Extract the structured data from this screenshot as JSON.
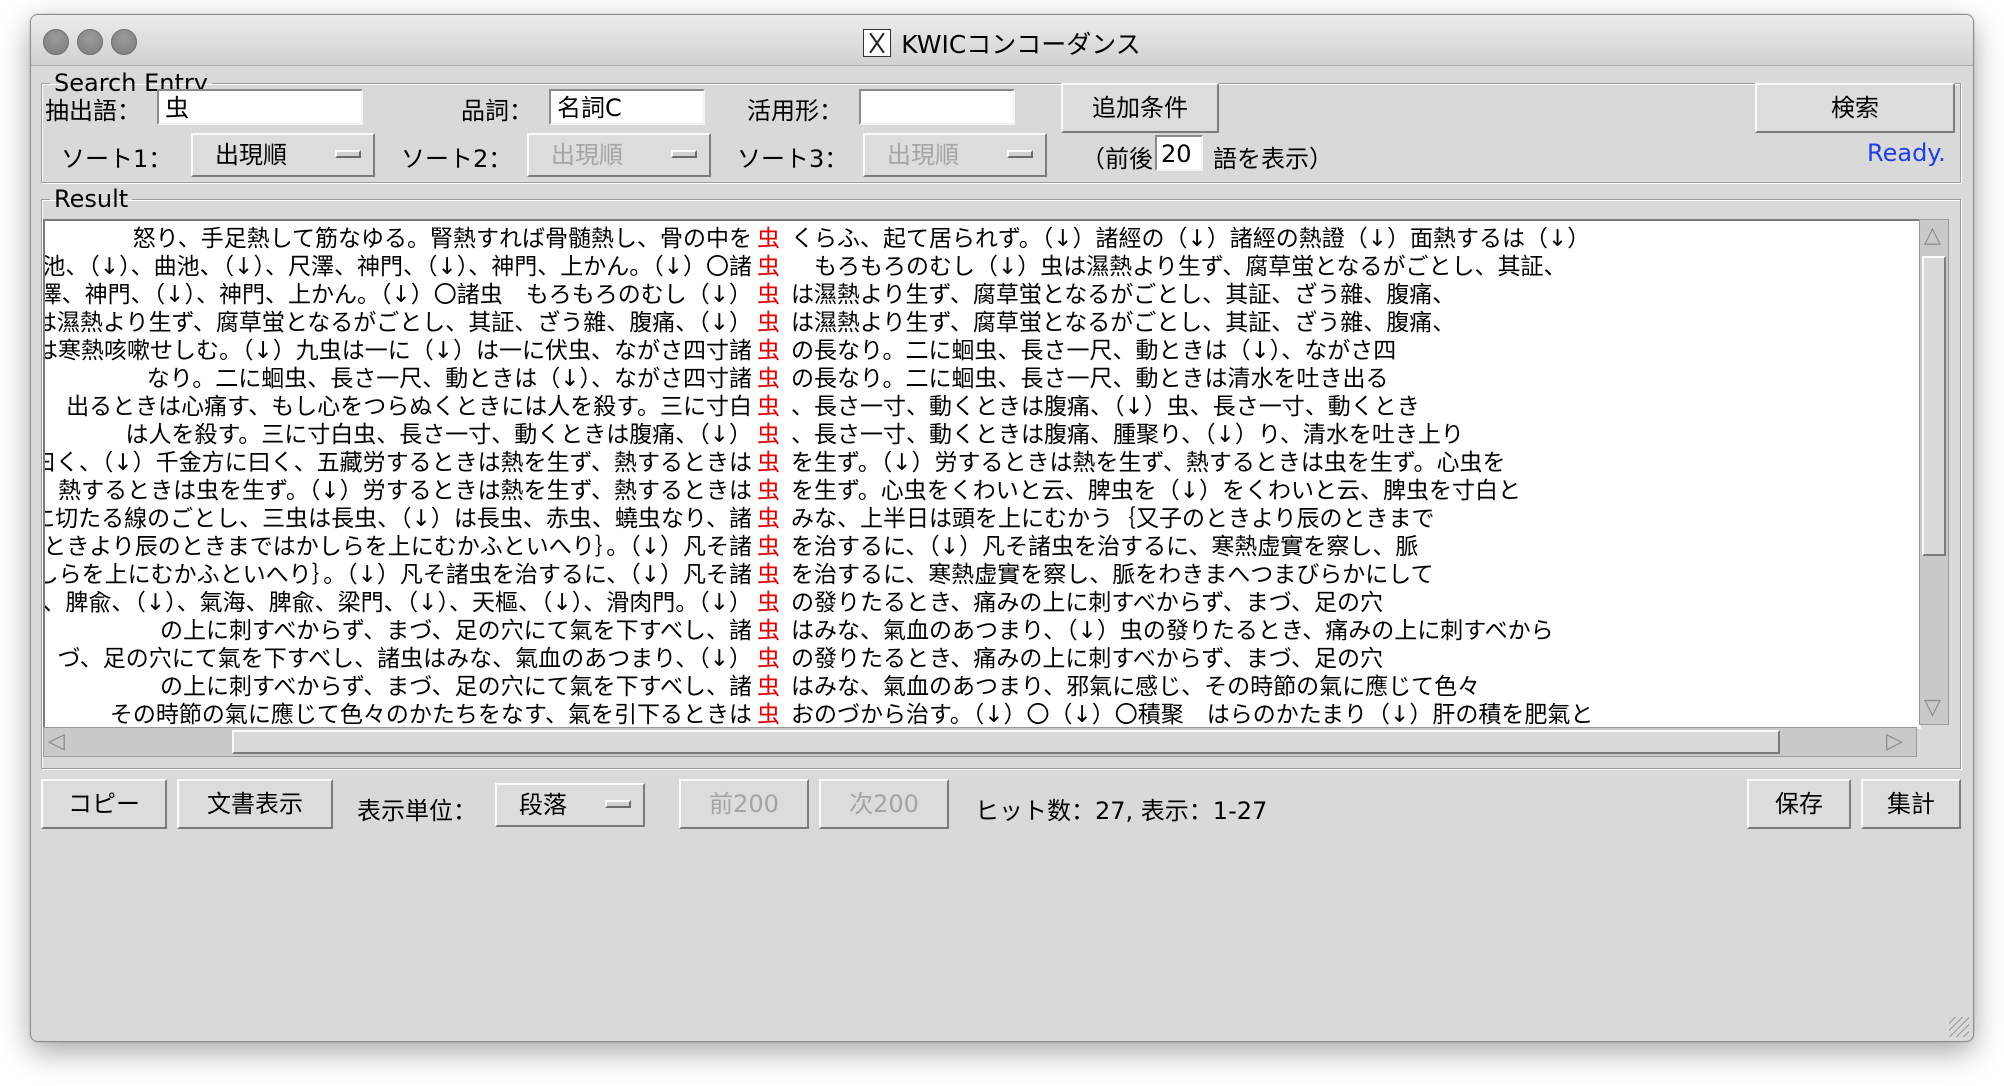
{
  "window": {
    "title": "KWICコンコーダンス"
  },
  "search_entry": {
    "legend": "Search Entry",
    "extract_label": "抽出語：",
    "extract_value": "虫",
    "pos_label": "品詞：",
    "pos_value": "名詞C",
    "conj_label": "活用形：",
    "conj_value": "",
    "add_condition_button": "追加条件",
    "search_button": "検索",
    "sort1_label": "ソート1：",
    "sort1_value": "出現順",
    "sort2_label": "ソート2：",
    "sort2_value": "出現順",
    "sort3_label": "ソート3：",
    "sort3_value": "出現順",
    "context_prefix": "（前後",
    "context_value": "20",
    "context_suffix": "語を表示）",
    "status": "Ready."
  },
  "result": {
    "legend": "Result",
    "keyword": "虫",
    "rows": [
      {
        "left": "怒り、手足熱して筋なゆる。腎熱すれば骨髄熱し、骨の中を",
        "right": "くらふ、起て居られず。（↓）諸經の（↓）諸經の熱證（↓）面熱するは（↓）"
      },
      {
        "left": "池、（↓）、曲池、（↓）、尺澤、神門、（↓）、神門、上かん。（↓）〇諸",
        "right": "　もろもろのむし（↓）虫は濕熱より生ず、腐草蛍となるがごとし、其証、"
      },
      {
        "left": "、尺澤、神門、（↓）、神門、上かん。（↓）〇諸虫　もろもろのむし（↓）",
        "right": "は濕熱より生ず、腐草蛍となるがごとし、其証、ざう雜、腹痛、"
      },
      {
        "left": "は濕熱より生ず、腐草蛍となるがごとし、其証、ざう雜、腹痛、（↓）",
        "right": "は濕熱より生ず、腐草蛍となるがごとし、其証、ざう雜、腹痛、"
      },
      {
        "left": "は寒熱咳嗽せしむ。（↓）九虫は一に（↓）は一に伏虫、ながさ四寸諸",
        "right": "の長なり。二に蛔虫、長さ一尺、動ときは（↓）、ながさ四"
      },
      {
        "left": "なり。二に蛔虫、長さ一尺、動ときは（↓）、ながさ四寸諸",
        "right": "の長なり。二に蛔虫、長さ一尺、動ときは清水を吐き出る"
      },
      {
        "left": "出るときは心痛す、もし心をつらぬくときには人を殺す。三に寸白",
        "right": "、長さ一寸、動くときは腹痛、（↓）虫、長さ一寸、動くとき"
      },
      {
        "left": "は人を殺す。三に寸白虫、長さ一寸、動くときは腹痛、（↓）",
        "right": "、長さ一寸、動くときは腹痛、腫聚り、（↓）り、清水を吐き上り"
      },
      {
        "left": "に曰く、（↓）千金方に曰く、五藏労するときは熱を生ず、熱するときは",
        "right": "を生ず。（↓）労するときは熱を生ず、熱するときは虫を生ず。心虫を"
      },
      {
        "left": "、熱するときは虫を生ず。（↓）労するときは熱を生ず、熱するときは",
        "right": "を生ず。心虫をくわいと云、脾虫を（↓）をくわいと云、脾虫を寸白と"
      },
      {
        "left": "に切たる線のごとし、三虫は長虫、（↓）は長虫、赤虫、蟯虫なり、諸",
        "right": "みな、上半日は頭を上にむかう｛又子のときより辰のときまで"
      },
      {
        "left": "子のときより辰のときまではかしらを上にむかふといへり｝。（↓）凡そ諸",
        "right": "を治するに、（↓）凡そ諸虫を治するに、寒熱虚實を察し、脈"
      },
      {
        "left": "はかしらを上にむかふといへり｝。（↓）凡そ諸虫を治するに、（↓）凡そ諸",
        "right": "を治するに、寒熱虚實を察し、脈をわきまへつまびらかにして"
      },
      {
        "left": "、脾兪、（↓）、氣海、脾兪、梁門、（↓）、天樞、（↓）、滑肉門。（↓）",
        "right": "の發りたるとき、痛みの上に刺すべからず、まづ、足の穴"
      },
      {
        "left": "の上に刺すべからず、まづ、足の穴にて氣を下すべし、諸",
        "right": "はみな、氣血のあつまり、（↓）虫の發りたるとき、痛みの上に刺すべから"
      },
      {
        "left": "づ、足の穴にて氣を下すべし、諸虫はみな、氣血のあつまり、（↓）",
        "right": "の發りたるとき、痛みの上に刺すべからず、まづ、足の穴"
      },
      {
        "left": "の上に刺すべからず、まづ、足の穴にて氣を下すべし、諸",
        "right": "はみな、氣血のあつまり、邪氣に感じ、その時節の氣に應じて色々"
      },
      {
        "left": "その時節の氣に應じて色々のかたちをなす、氣を引下るときは",
        "right": "おのづから治す。（↓）〇（↓）〇積聚　はらのかたまり（↓）肝の積を肥氣と"
      }
    ]
  },
  "footer": {
    "copy_button": "コピー",
    "doc_view_button": "文書表示",
    "unit_label": "表示単位：",
    "unit_value": "段落",
    "prev_button": "前200",
    "next_button": "次200",
    "hits_text": "ヒット数：27, 表示：1-27",
    "save_button": "保存",
    "aggregate_button": "集計"
  }
}
